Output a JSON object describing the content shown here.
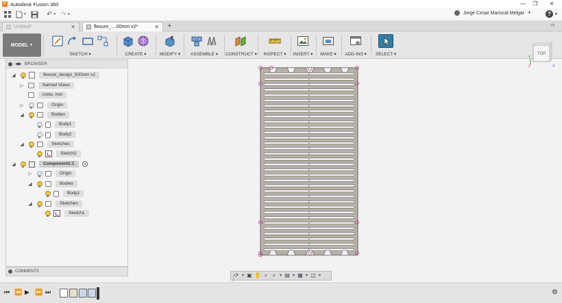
{
  "window": {
    "title": "Autodesk Fusion 360"
  },
  "qab": {
    "user_name": "Jorge Cesar Mariscal Melgar"
  },
  "tabs": [
    {
      "label": "Untitled*"
    },
    {
      "label": "flexure_....00mm v2*"
    }
  ],
  "ribbon": {
    "model_label": "MODEL",
    "groups": [
      {
        "label": "SKETCH ▾"
      },
      {
        "label": "CREATE ▾"
      },
      {
        "label": "MODIFY ▾"
      },
      {
        "label": "ASSEMBLE ▾"
      },
      {
        "label": "CONSTRUCT ▾"
      },
      {
        "label": "INSPECT ▾"
      },
      {
        "label": "INSERT ▾"
      },
      {
        "label": "MAKE ▾"
      },
      {
        "label": "ADD-INS ▾"
      },
      {
        "label": "SELECT ▾"
      }
    ]
  },
  "browser": {
    "header": "BROWSER",
    "items": [
      {
        "label": "flexure_design_500mm v2"
      },
      {
        "label": "Named Views"
      },
      {
        "label": "Units: mm"
      },
      {
        "label": "Origin"
      },
      {
        "label": "Bodies"
      },
      {
        "label": "Body1"
      },
      {
        "label": "Body2"
      },
      {
        "label": "Sketches"
      },
      {
        "label": "Sketch2"
      },
      {
        "label": "Component1:1"
      },
      {
        "label": "Origin"
      },
      {
        "label": "Bodies"
      },
      {
        "label": "Body1"
      },
      {
        "label": "Sketches"
      },
      {
        "label": "Sketch1"
      }
    ]
  },
  "comments": {
    "header": "COMMENTS"
  },
  "viewcube": {
    "face_label": "TOP"
  },
  "colors": {
    "part_fill": "#b8b1a6",
    "part_stroke": "#4a4a4a",
    "select_accent": "#2f7fa6",
    "sketch_point": "#b43a8a"
  }
}
